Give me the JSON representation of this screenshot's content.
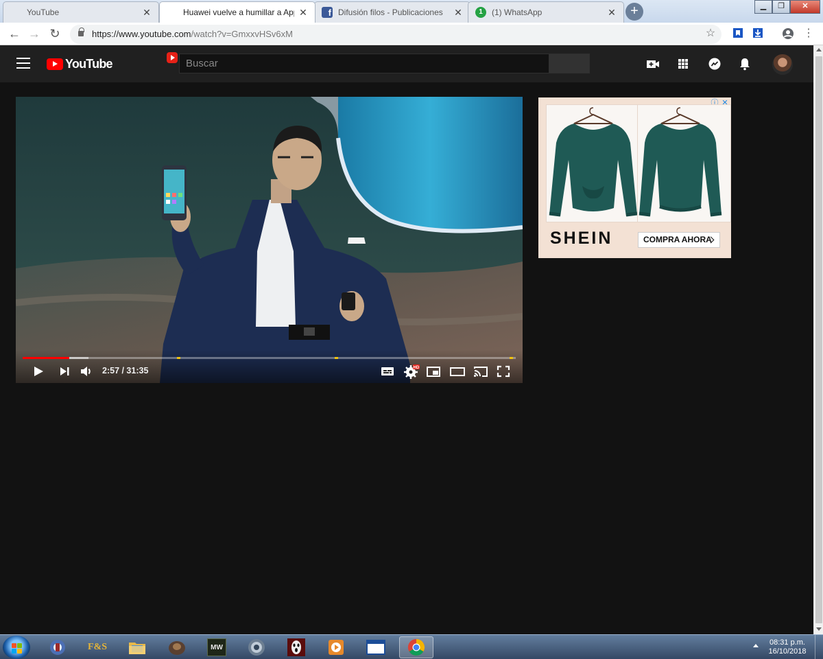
{
  "browser": {
    "tabs": [
      {
        "title": "YouTube",
        "icon": "youtube-favicon",
        "active": false
      },
      {
        "title": "Huawei vuelve a humillar a Apple",
        "icon": "youtube-favicon",
        "active": true
      },
      {
        "title": "Difusión filos - Publicaciones",
        "icon": "facebook-favicon",
        "active": false
      },
      {
        "title": "(1) WhatsApp",
        "icon": "whatsapp-favicon",
        "active": false
      }
    ],
    "url_host": "https://www.youtube.com",
    "url_path": "/watch?v=GmxxvHSv6xM",
    "whatsapp_badge": "1"
  },
  "youtube": {
    "logo_text": "YouTube",
    "search_placeholder": "Buscar",
    "player": {
      "current_time": "2:57",
      "duration": "31:35",
      "time_display": "2:57 / 31:35",
      "played_fraction": 0.094,
      "buffered_fraction": 0.133,
      "chapter_marks_fraction": [
        0.32,
        0.64,
        0.995
      ],
      "quality_badge": "HD"
    },
    "ad": {
      "brand": "SHEIN",
      "cta": "COMPRA AHORA"
    }
  },
  "taskbar": {
    "apps": [
      "ie-icon",
      "fs-app-icon",
      "folder-icon",
      "game-icon",
      "mw-game-icon",
      "settings-gear-icon",
      "scream-icon",
      "media-player-icon",
      "window-icon",
      "chrome-icon"
    ],
    "fs_label": "F&S",
    "mw_label": "MW",
    "time": "08:31 p.m.",
    "date": "16/10/2018"
  },
  "colors": {
    "youtube_red": "#ff0000",
    "youtube_bg": "#121212",
    "header_bg": "#202020",
    "progress_played": "#ff0000",
    "chapter_mark": "#f1c40f"
  }
}
